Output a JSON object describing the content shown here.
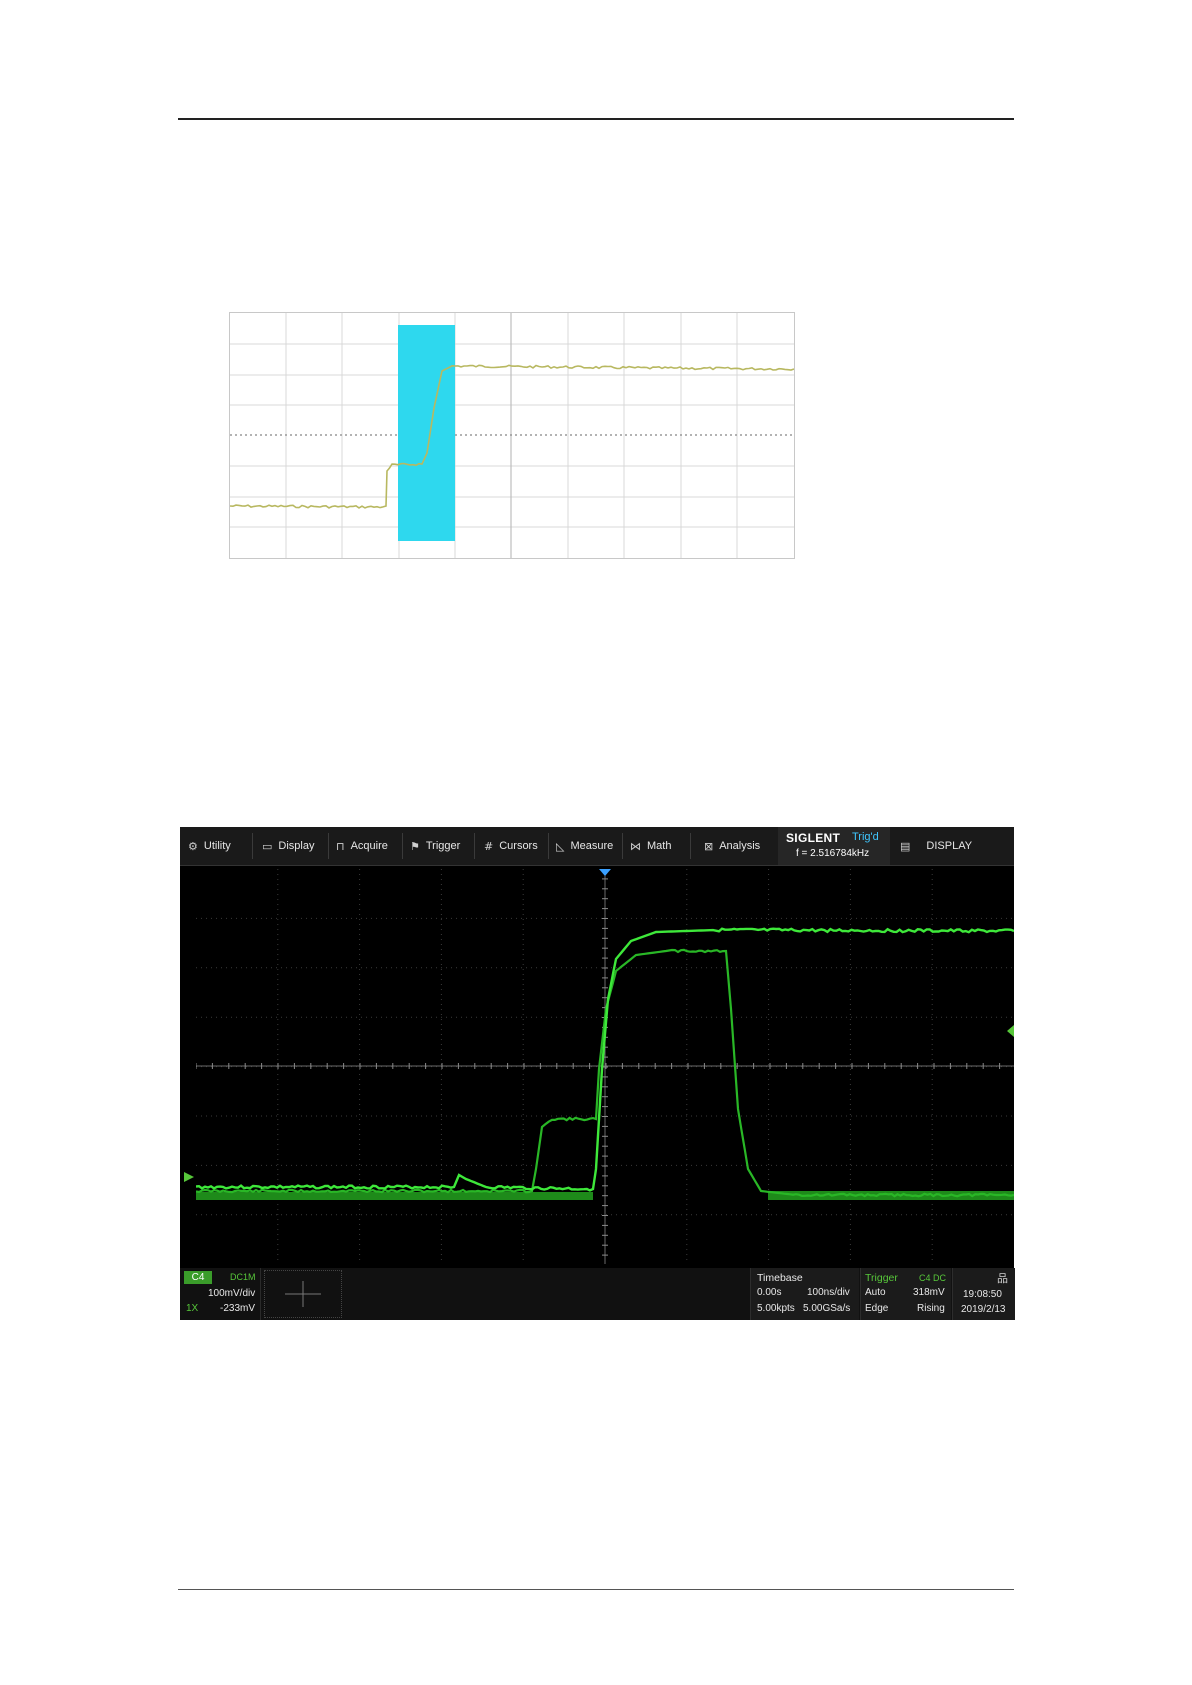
{
  "menu": {
    "items": [
      {
        "label": "Utility",
        "icon": "gear-icon",
        "glyph": "⚙"
      },
      {
        "label": "Display",
        "icon": "monitor-icon",
        "glyph": "▭"
      },
      {
        "label": "Acquire",
        "icon": "acquire-icon",
        "glyph": "⊓"
      },
      {
        "label": "Trigger",
        "icon": "flag-icon",
        "glyph": "⚑"
      },
      {
        "label": "Cursors",
        "icon": "cursors-icon",
        "glyph": "#"
      },
      {
        "label": "Measure",
        "icon": "measure-icon",
        "glyph": "◺"
      },
      {
        "label": "Math",
        "icon": "math-icon",
        "glyph": "⋈"
      },
      {
        "label": "Analysis",
        "icon": "analysis-icon",
        "glyph": "⊠"
      }
    ],
    "display_label": "DISPLAY",
    "display_icon": "document-icon"
  },
  "brand": {
    "name": "SIGLENT",
    "trigger_state": "Trig'd",
    "frequency": "f = 2.516784kHz"
  },
  "channel": {
    "name": "C4",
    "coupling": "DC1M",
    "scale": "100mV/div",
    "probe": "1X",
    "offset": "-233mV"
  },
  "timebase": {
    "title": "Timebase",
    "delay": "0.00s",
    "scale": "100ns/div",
    "memory": "5.00kpts",
    "sample_rate": "5.00GSa/s"
  },
  "trigger": {
    "title": "Trigger",
    "source": "C4 DC",
    "mode": "Auto",
    "level": "318mV",
    "type": "Edge",
    "slope": "Rising"
  },
  "clock": {
    "time": "19:08:50",
    "date": "2019/2/13"
  },
  "colors": {
    "trace": "#3ee83a",
    "trace_dark": "#1e8a1a",
    "highlight": "#2ed8ee",
    "thumb_trace": "#b8b860",
    "scope_bg": "#000000"
  }
}
